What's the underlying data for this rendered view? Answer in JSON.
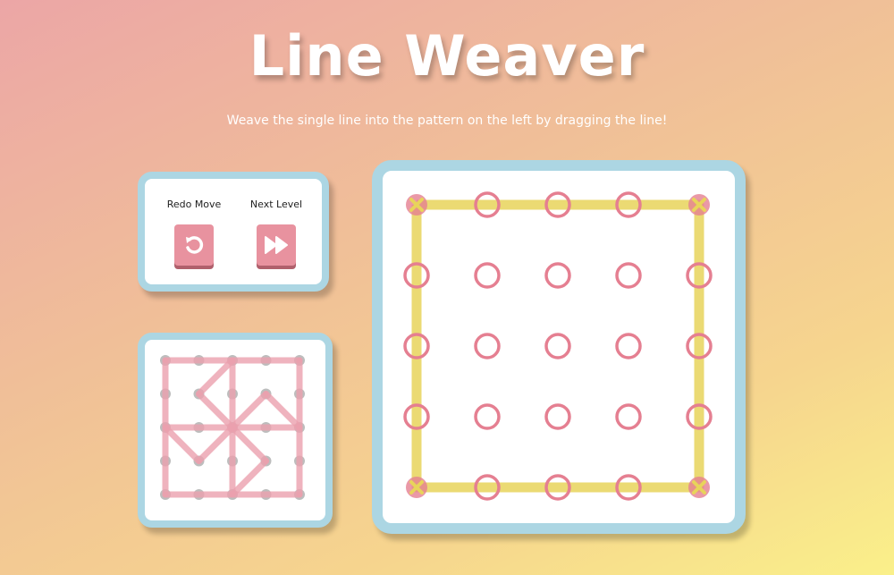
{
  "header": {
    "title": "Line Weaver",
    "subtitle": "Weave the single line into the pattern on the left by dragging the line!"
  },
  "controls": {
    "redo_label": "Redo Move",
    "next_label": "Next Level",
    "redo_icon": "redo-icon",
    "next_icon": "fast-forward-icon"
  },
  "colors": {
    "line": "#e8d45a",
    "node": "#e57f91",
    "pattern": "#eba0ae",
    "accent": "#e8929f",
    "frame": "#acd6e3"
  },
  "grid": {
    "rows": 5,
    "cols": 5
  },
  "pattern_segments": [
    [
      [
        0,
        0
      ],
      [
        4,
        0
      ]
    ],
    [
      [
        0,
        0
      ],
      [
        0,
        4
      ]
    ],
    [
      [
        0,
        4
      ],
      [
        4,
        4
      ]
    ],
    [
      [
        4,
        0
      ],
      [
        4,
        4
      ]
    ],
    [
      [
        2,
        0
      ],
      [
        2,
        4
      ]
    ],
    [
      [
        0,
        2
      ],
      [
        4,
        2
      ]
    ],
    [
      [
        2,
        0
      ],
      [
        1,
        1
      ]
    ],
    [
      [
        1,
        1
      ],
      [
        2,
        2
      ]
    ],
    [
      [
        2,
        2
      ],
      [
        3,
        1
      ]
    ],
    [
      [
        3,
        1
      ],
      [
        4,
        2
      ]
    ],
    [
      [
        0,
        2
      ],
      [
        1,
        3
      ]
    ],
    [
      [
        1,
        3
      ],
      [
        2,
        2
      ]
    ],
    [
      [
        2,
        2
      ],
      [
        3,
        3
      ]
    ],
    [
      [
        3,
        3
      ],
      [
        2,
        4
      ]
    ]
  ],
  "player_line": [
    [
      0,
      0
    ],
    [
      4,
      0
    ],
    [
      4,
      4
    ],
    [
      0,
      4
    ],
    [
      0,
      0
    ]
  ],
  "pinned_nodes": [
    [
      0,
      0
    ],
    [
      4,
      0
    ],
    [
      0,
      4
    ],
    [
      4,
      4
    ]
  ]
}
